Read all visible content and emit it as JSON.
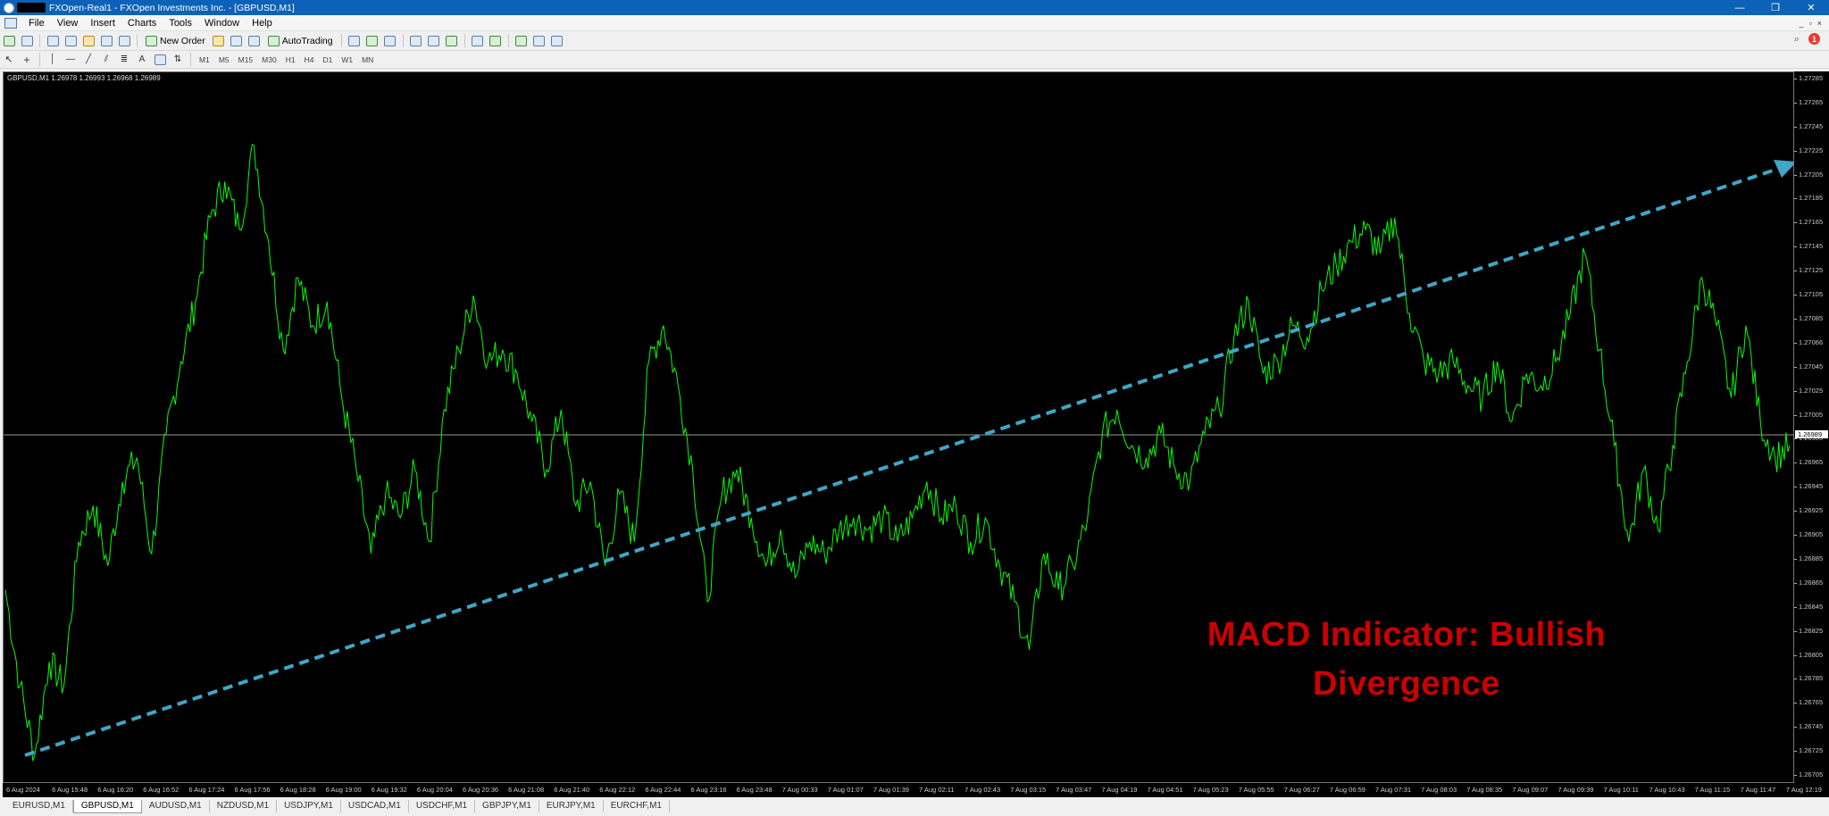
{
  "titlebar": {
    "title": "FXOpen-Real1 - FXOpen Investments Inc. - [GBPUSD,M1]",
    "minimize": "—",
    "maximize": "❐",
    "close": "✕"
  },
  "menu": [
    "File",
    "View",
    "Insert",
    "Charts",
    "Tools",
    "Window",
    "Help"
  ],
  "mdi_controls": [
    "_",
    "▫",
    "×"
  ],
  "toolbar": {
    "new_order": "New Order",
    "autotrading": "AutoTrading",
    "alert_count": "1"
  },
  "toolbar2": {
    "draw_text": "A",
    "timeframes": [
      "M1",
      "M5",
      "M15",
      "M30",
      "H1",
      "H4",
      "D1",
      "W1",
      "MN"
    ]
  },
  "chart": {
    "symbol_info": "GBPUSD,M1  1.26978 1.26993 1.26968 1.26989",
    "current_price": "1.26989",
    "annotation_line1": "MACD Indicator: Bullish",
    "annotation_line2": "Divergence",
    "line_color": "#00ff00",
    "arrow_color": "#3fa6c6",
    "annotation_color": "#cc0000",
    "price_labels": [
      "1.27285",
      "1.27265",
      "1.27245",
      "1.27225",
      "1.27205",
      "1.27185",
      "1.27165",
      "1.27145",
      "1.27125",
      "1.27105",
      "1.27085",
      "1.27066",
      "1.27045",
      "1.27025",
      "1.27005",
      "1.26985",
      "1.26965",
      "1.26945",
      "1.26925",
      "1.26905",
      "1.26885",
      "1.26865",
      "1.26845",
      "1.26825",
      "1.26805",
      "1.26785",
      "1.26765",
      "1.26745",
      "1.26725",
      "1.26705"
    ],
    "time_labels": [
      "6 Aug 2024",
      "6 Aug 15:48",
      "6 Aug 16:20",
      "6 Aug 16:52",
      "6 Aug 17:24",
      "6 Aug 17:56",
      "6 Aug 18:28",
      "6 Aug 19:00",
      "6 Aug 19:32",
      "6 Aug 20:04",
      "6 Aug 20:36",
      "6 Aug 21:08",
      "6 Aug 21:40",
      "6 Aug 22:12",
      "6 Aug 22:44",
      "6 Aug 23:16",
      "6 Aug 23:48",
      "7 Aug 00:33",
      "7 Aug 01:07",
      "7 Aug 01:39",
      "7 Aug 02:11",
      "7 Aug 02:43",
      "7 Aug 03:15",
      "7 Aug 03:47",
      "7 Aug 04:19",
      "7 Aug 04:51",
      "7 Aug 05:23",
      "7 Aug 05:55",
      "7 Aug 06:27",
      "7 Aug 06:59",
      "7 Aug 07:31",
      "7 Aug 08:03",
      "7 Aug 08:35",
      "7 Aug 09:07",
      "7 Aug 09:39",
      "7 Aug 10:11",
      "7 Aug 10:43",
      "7 Aug 11:15",
      "7 Aug 11:47",
      "7 Aug 12:19"
    ],
    "price_series": [
      1.2686,
      1.2678,
      1.26722,
      1.268,
      1.2678,
      1.269,
      1.2693,
      1.2688,
      1.2695,
      1.2697,
      1.2689,
      1.2699,
      1.2705,
      1.271,
      1.2717,
      1.272,
      1.2716,
      1.2723,
      1.2715,
      1.2706,
      1.2712,
      1.2708,
      1.271,
      1.2702,
      1.2696,
      1.2689,
      1.2694,
      1.2692,
      1.2696,
      1.269,
      1.2701,
      1.2706,
      1.27105,
      1.2705,
      1.2706,
      1.2704,
      1.27,
      1.2696,
      1.2701,
      1.2693,
      1.2695,
      1.2688,
      1.2694,
      1.269,
      1.2705,
      1.2708,
      1.2703,
      1.2696,
      1.2685,
      1.2694,
      1.2696,
      1.2692,
      1.2688,
      1.2691,
      1.2687,
      1.269,
      1.2689,
      1.2691,
      1.2692,
      1.2691,
      1.2692,
      1.269,
      1.2692,
      1.2695,
      1.2692,
      1.2693,
      1.269,
      1.2692,
      1.2688,
      1.2685,
      1.2681,
      1.2689,
      1.2686,
      1.2688,
      1.2692,
      1.2699,
      1.2701,
      1.2698,
      1.2697,
      1.2699,
      1.2696,
      1.2695,
      1.2699,
      1.2701,
      1.2707,
      1.271,
      1.2704,
      1.2705,
      1.2708,
      1.2707,
      1.2711,
      1.2713,
      1.2715,
      1.2716,
      1.2714,
      1.2717,
      1.2709,
      1.2705,
      1.2704,
      1.2705,
      1.2703,
      1.2702,
      1.2705,
      1.27,
      1.2704,
      1.2703,
      1.2705,
      1.2709,
      1.2714,
      1.2706,
      1.2698,
      1.269,
      1.2696,
      1.2691,
      1.2698,
      1.2705,
      1.2712,
      1.2708,
      1.2702,
      1.2708,
      1.27,
      1.2697,
      1.2698
    ]
  },
  "tabs": [
    "EURUSD,M1",
    "GBPUSD,M1",
    "AUDUSD,M1",
    "NZDUSD,M1",
    "USDJPY,M1",
    "USDCAD,M1",
    "USDCHF,M1",
    "GBPJPY,M1",
    "EURJPY,M1",
    "EURCHF,M1"
  ],
  "active_tab": "GBPUSD,M1"
}
